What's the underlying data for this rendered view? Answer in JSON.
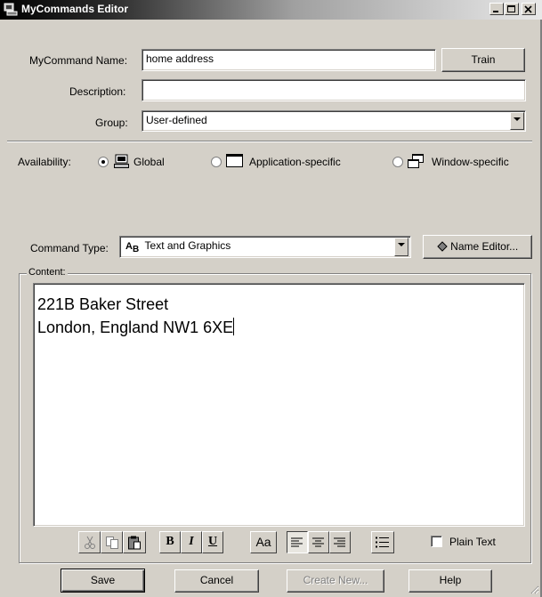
{
  "window": {
    "title": "MyCommands Editor"
  },
  "form": {
    "name_label": "MyCommand Name:",
    "name_value": "home address",
    "train_label": "Train",
    "description_label": "Description:",
    "description_value": "",
    "group_label": "Group:",
    "group_value": "User-defined"
  },
  "availability": {
    "label": "Availability:",
    "options": [
      {
        "label": "Global",
        "selected": true,
        "icon": "keyboard-icon"
      },
      {
        "label": "Application-specific",
        "selected": false,
        "icon": "application-window-icon"
      },
      {
        "label": "Window-specific",
        "selected": false,
        "icon": "windows-icon"
      }
    ]
  },
  "command_type": {
    "label": "Command Type:",
    "value": "Text and Graphics",
    "icon": "text-graphics-icon",
    "name_editor_label": "Name Editor..."
  },
  "content": {
    "group_label": "Content:",
    "lines": [
      "221B Baker Street",
      "London, England NW1 6XE"
    ],
    "plain_text_label": "Plain Text",
    "plain_text_checked": false,
    "toolbar": {
      "bold": "B",
      "italic": "I",
      "underline": "U",
      "font": "Aa"
    }
  },
  "footer": {
    "save": "Save",
    "cancel": "Cancel",
    "create_new": "Create New...",
    "help": "Help"
  }
}
